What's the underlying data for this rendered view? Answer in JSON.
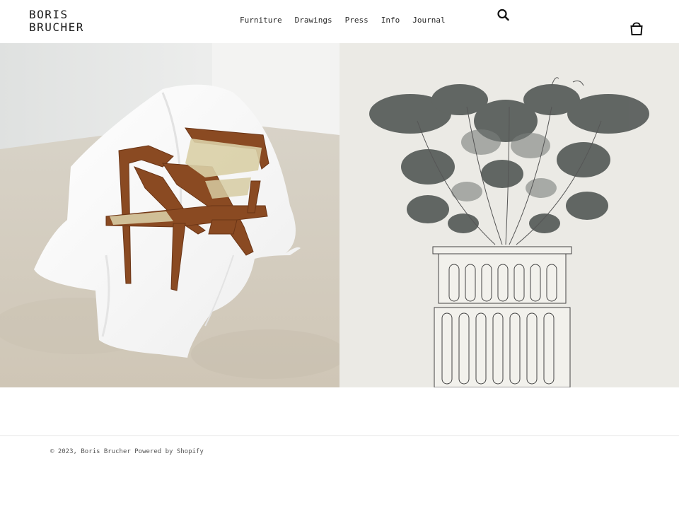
{
  "header": {
    "logo_line1": "BORIS",
    "logo_line2": "BRUCHER",
    "nav": [
      {
        "label": "Furniture"
      },
      {
        "label": "Drawings"
      },
      {
        "label": "Press"
      },
      {
        "label": "Info"
      },
      {
        "label": "Journal"
      }
    ],
    "search_icon": "search-icon",
    "cart_icon": "cart-icon"
  },
  "hero": {
    "left_image": "chair-on-draped-plinth",
    "right_image": "drawing-flowers-on-column"
  },
  "footer": {
    "copyright": "© 2023,",
    "owner": "Boris Brucher",
    "powered": "Powered by Shopify"
  },
  "colors": {
    "background": "#ffffff",
    "text": "#222222",
    "divider": "#e6e6e6"
  }
}
